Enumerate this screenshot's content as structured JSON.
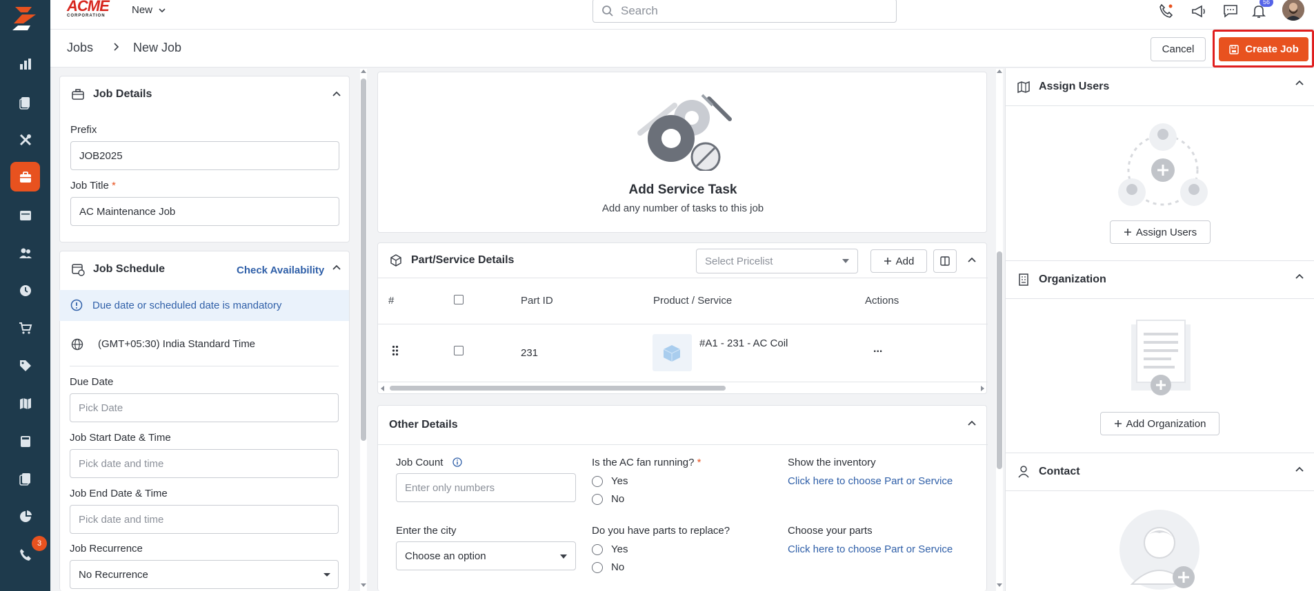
{
  "topbar": {
    "logo_text": "ACME",
    "logo_sub": "CORPORATION",
    "new_label": "New",
    "search_placeholder": "Search",
    "notification_count": "56"
  },
  "sidebar": {
    "items": [
      "dashboard",
      "reports",
      "quotes",
      "jobs",
      "calendar",
      "customers",
      "timesheets",
      "store",
      "pricing",
      "map",
      "invoices",
      "documents",
      "analytics",
      "support"
    ],
    "active": "jobs",
    "support_badge": "3"
  },
  "breadcrumb": {
    "parent": "Jobs",
    "current": "New Job"
  },
  "actions": {
    "cancel": "Cancel",
    "create": "Create Job"
  },
  "job_details": {
    "title": "Job Details",
    "prefix_label": "Prefix",
    "prefix_value": "JOB2025",
    "job_title_label": "Job Title",
    "job_title_value": "AC Maintenance Job"
  },
  "job_schedule": {
    "title": "Job Schedule",
    "check_availability": "Check Availability",
    "info": "Due date or scheduled date is mandatory",
    "timezone": "(GMT+05:30) India Standard Time",
    "due_date_label": "Due Date",
    "due_date_placeholder": "Pick Date",
    "start_label": "Job Start Date & Time",
    "start_placeholder": "Pick date and time",
    "end_label": "Job End Date & Time",
    "end_placeholder": "Pick date and time",
    "recurrence_label": "Job Recurrence",
    "recurrence_value": "No Recurrence"
  },
  "service_task": {
    "title": "Add Service Task",
    "subtitle": "Add any number of tasks to this job"
  },
  "parts": {
    "title": "Part/Service Details",
    "pricelist_placeholder": "Select Pricelist",
    "add_label": "Add",
    "columns": [
      "#",
      "Part ID",
      "Product / Service",
      "Actions"
    ],
    "rows": [
      {
        "part_id": "231",
        "product": "#A1 - 231 - AC Coil",
        "actions": "..."
      }
    ]
  },
  "other_details": {
    "title": "Other Details",
    "job_count_label": "Job Count",
    "job_count_placeholder": "Enter only numbers",
    "fan_label": "Is the AC fan running?",
    "fan_options": [
      "Yes",
      "No"
    ],
    "inventory_label": "Show the inventory",
    "inventory_link": "Click here to choose Part or Service",
    "city_label": "Enter the city",
    "city_value": "Choose an option",
    "replace_label": "Do you have parts to replace?",
    "replace_options": [
      "Yes",
      "No"
    ],
    "parts_label": "Choose your parts",
    "parts_link": "Click here to choose Part or Service"
  },
  "right_panel": {
    "assign_title": "Assign Users",
    "assign_button": "Assign Users",
    "org_title": "Organization",
    "org_button": "Add Organization",
    "contact_title": "Contact"
  },
  "colors": {
    "accent": "#e8521f",
    "sidebar": "#1e3a4c",
    "link": "#2f5fa8",
    "highlight": "#e01e1e"
  }
}
